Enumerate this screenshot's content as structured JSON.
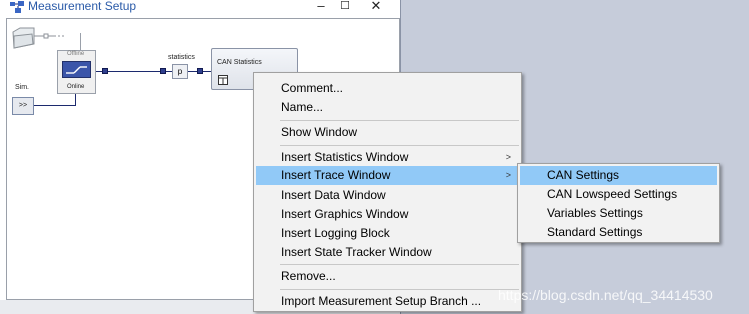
{
  "window": {
    "title": "Measurement Setup",
    "minimize_glyph": "–",
    "maximize_glyph": "☐",
    "close_glyph": "✕"
  },
  "diagram": {
    "offline_label": "Offline",
    "online_label": "Online",
    "sim_label": "Sim.",
    "sim_button": ">>",
    "statistics_label": "statistics",
    "p_block": "p",
    "can_statistics_label": "CAN Statistics"
  },
  "context_menu": {
    "items": [
      {
        "label": "Comment..."
      },
      {
        "label": "Name..."
      },
      {
        "label": "Show Window"
      },
      {
        "label": "Insert Statistics Window",
        "submenu": true
      },
      {
        "label": "Insert Trace Window",
        "submenu": true,
        "highlighted": true
      },
      {
        "label": "Insert Data Window"
      },
      {
        "label": "Insert Graphics Window"
      },
      {
        "label": "Insert Logging Block"
      },
      {
        "label": "Insert State Tracker Window"
      },
      {
        "label": "Remove..."
      },
      {
        "label": "Import Measurement Setup Branch ..."
      }
    ],
    "submenu_arrow": ">"
  },
  "trace_submenu": {
    "items": [
      {
        "label": "CAN Settings",
        "highlighted": true
      },
      {
        "label": "CAN Lowspeed Settings"
      },
      {
        "label": "Variables Settings"
      },
      {
        "label": "Standard Settings"
      }
    ]
  },
  "watermark": "https://blog.csdn.net/qq_34414530",
  "colors": {
    "highlight": "#91c9f7",
    "menu_bg": "#f2f2f2",
    "desktop_bg": "#c6ccda",
    "title_text": "#2a5aa8"
  }
}
